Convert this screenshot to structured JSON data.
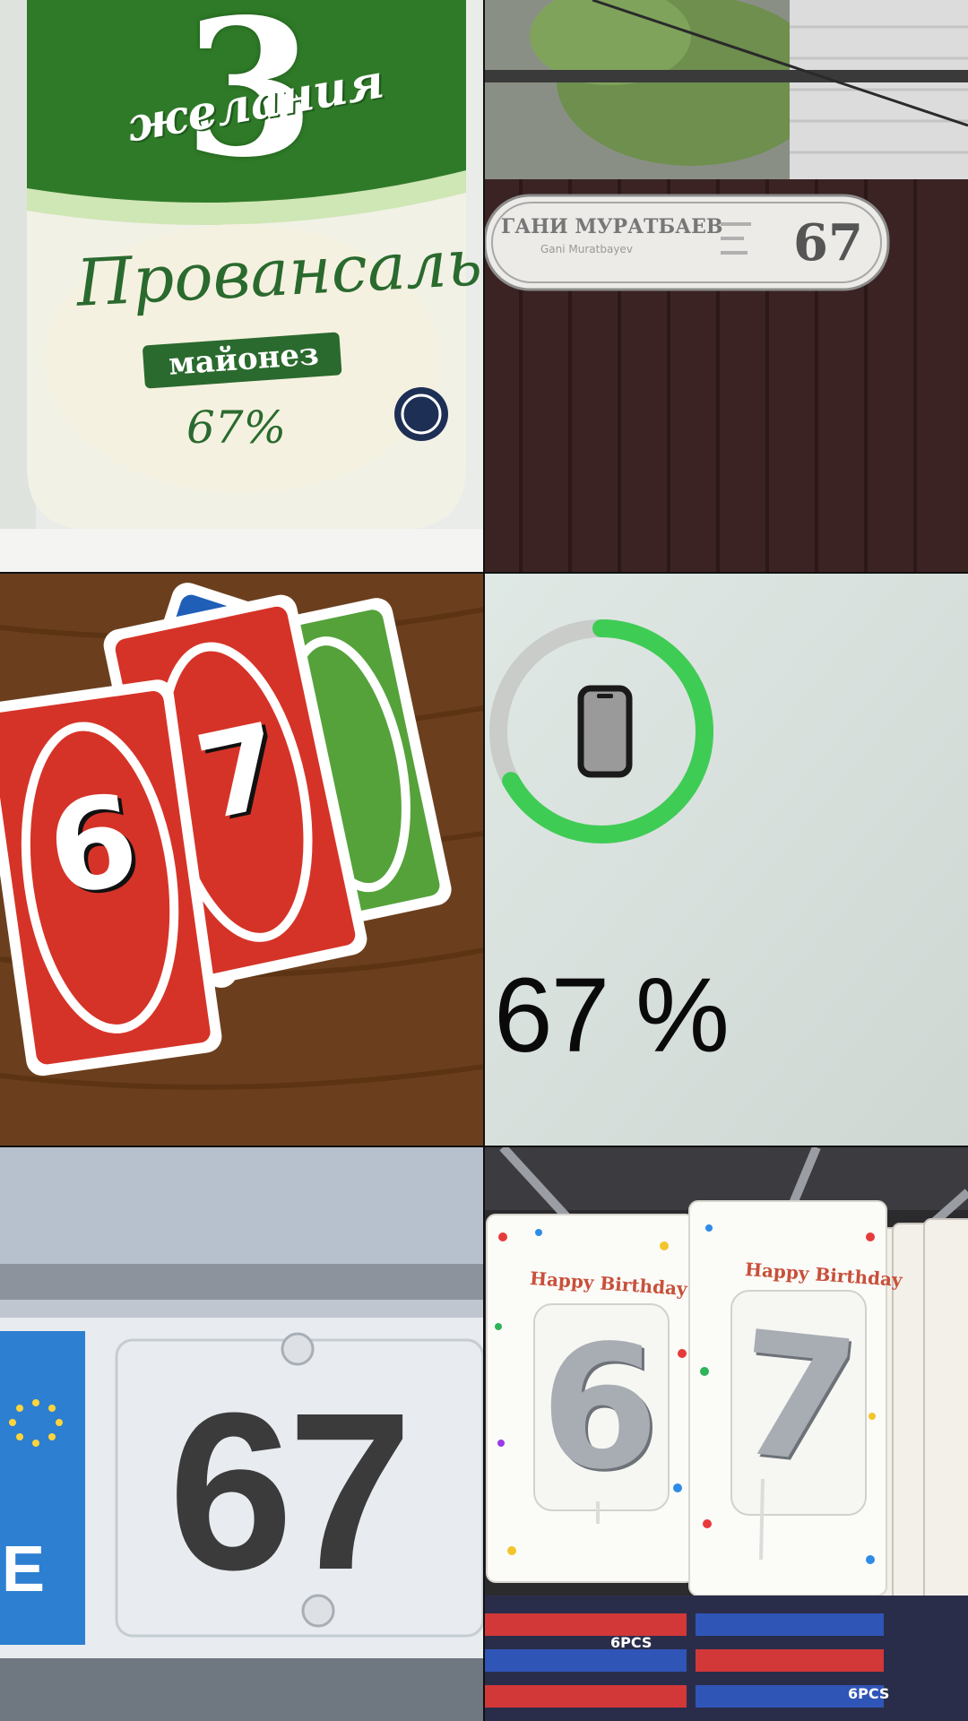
{
  "tiles": {
    "mayonnaise": {
      "brand_top": "3",
      "brand_word": "желания",
      "product": "Провансаль",
      "subtitle": "майонез",
      "fat": "67%"
    },
    "street_sign": {
      "name": "ГАНИ МУРАТБАЕВ",
      "latin": "Gani Muratbayev",
      "number": "67"
    },
    "uno_cards": {
      "card_six": "6",
      "card_seven": "7"
    },
    "battery": {
      "percent_text": "67 %",
      "level": 0.67,
      "ring_color": "#3fcc55",
      "track_color": "#c9ccc9",
      "icon": "phone-icon"
    },
    "license_plate": {
      "country": "E",
      "number": "67"
    },
    "candles": {
      "left_label": "Happy Birthday",
      "right_label": "Happy Birthday",
      "left_digit": "6",
      "right_digit": "7",
      "pack_text": "6PCS"
    }
  }
}
